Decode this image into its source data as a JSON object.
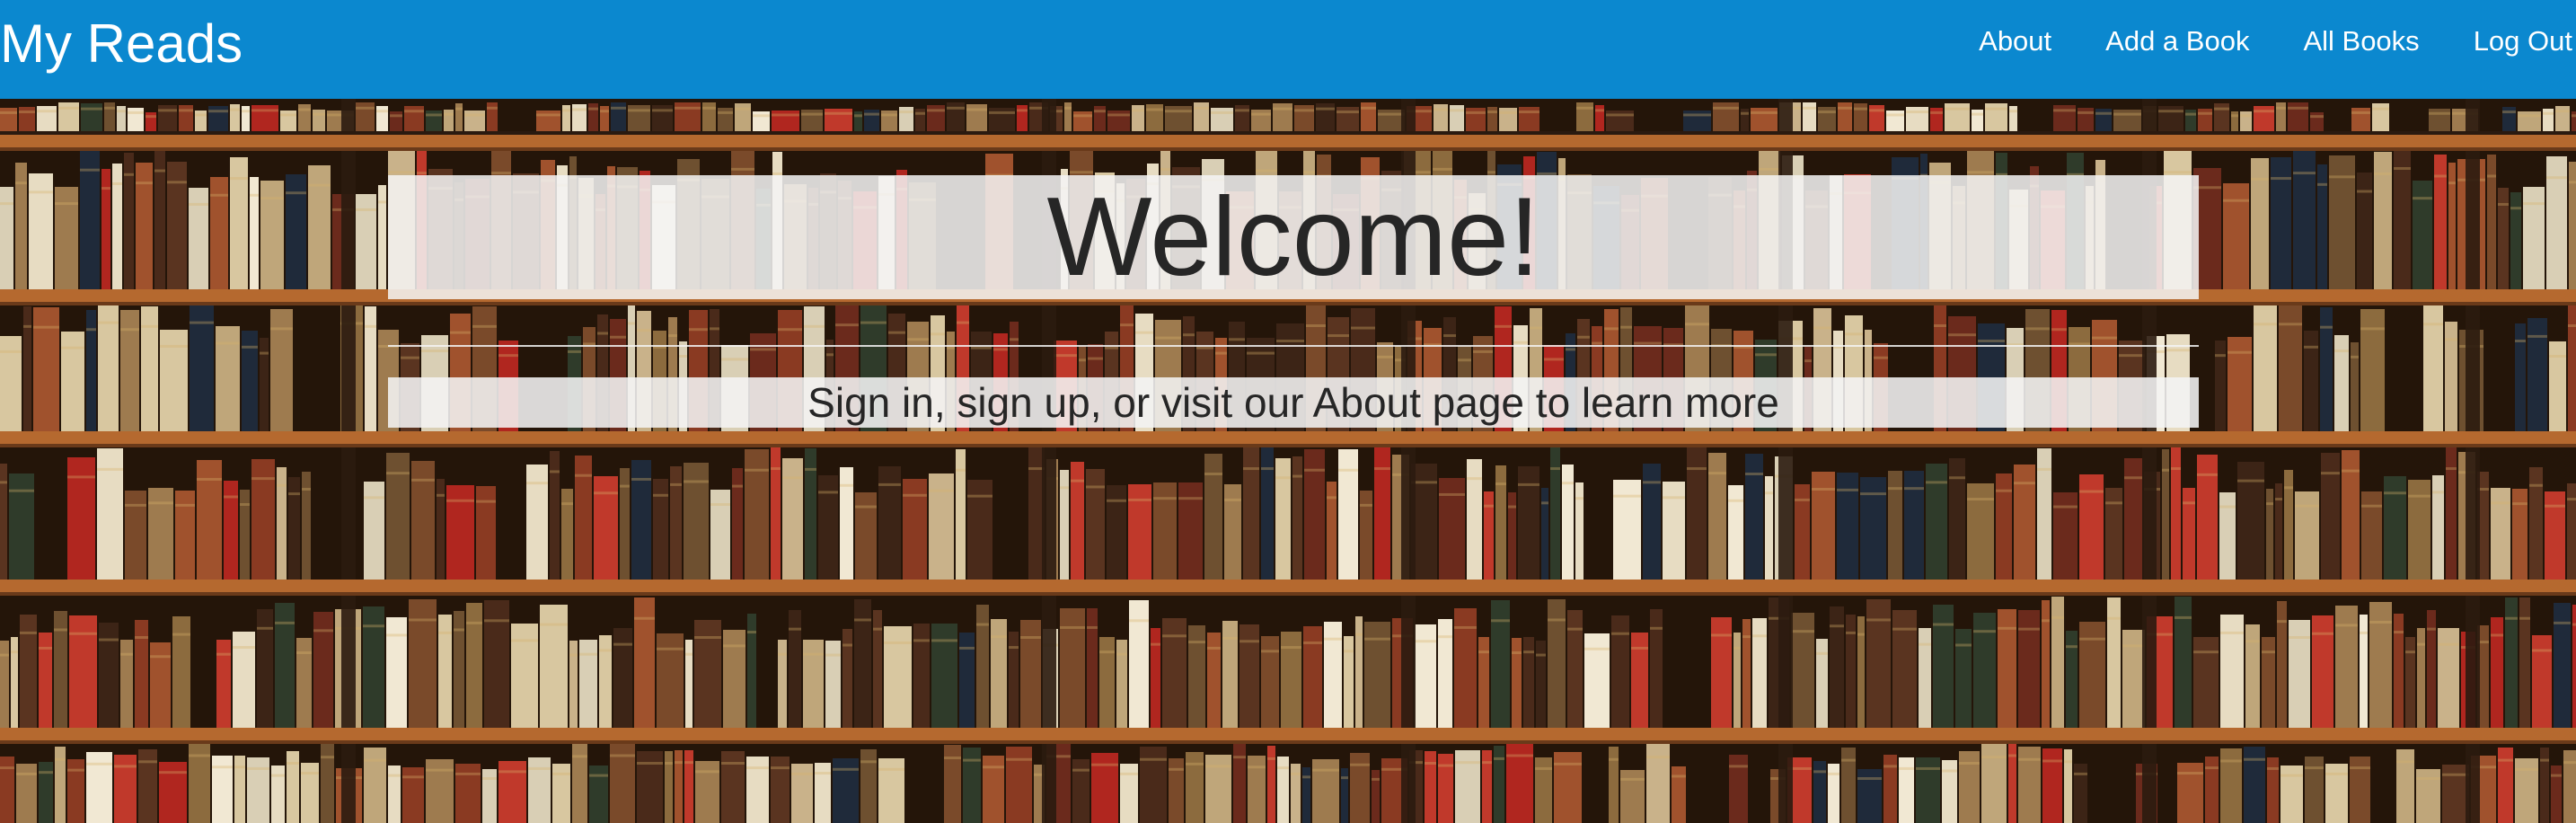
{
  "navbar": {
    "brand": "My Reads",
    "links": [
      {
        "label": "About"
      },
      {
        "label": "Add a Book"
      },
      {
        "label": "All Books"
      },
      {
        "label": "Log Out"
      }
    ],
    "background_color": "#0b88cf"
  },
  "hero": {
    "background_image": "bookshelf-photo",
    "title": "Welcome!",
    "subtitle": "Sign in, sign up, or visit our About page to learn more"
  }
}
